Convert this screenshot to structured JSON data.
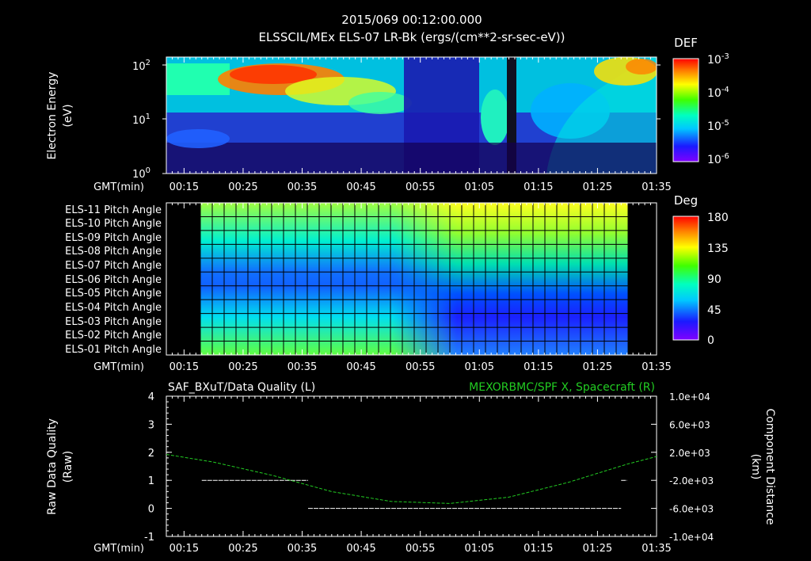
{
  "header": {
    "title_line1": "2015/069 00:12:00.000",
    "title_line2": "ELSSCIL/MEx ELS-07 LR-Bk  (ergs/(cm**2-sr-sec-eV))"
  },
  "time_axis": {
    "label": "GMT(min)",
    "ticks": [
      "00:15",
      "00:25",
      "00:35",
      "00:45",
      "00:55",
      "01:05",
      "01:15",
      "01:25",
      "01:35"
    ]
  },
  "panel1": {
    "ylabel_line1": "Electron Energy",
    "ylabel_line2": "(eV)",
    "yticks": [
      {
        "base": "10",
        "exp": "2"
      },
      {
        "base": "10",
        "exp": "1"
      },
      {
        "base": "10",
        "exp": "0"
      }
    ],
    "colorbar": {
      "title": "DEF",
      "ticks": [
        {
          "base": "10",
          "exp": "-3"
        },
        {
          "base": "10",
          "exp": "-4"
        },
        {
          "base": "10",
          "exp": "-5"
        },
        {
          "base": "10",
          "exp": "-6"
        }
      ]
    }
  },
  "panel2": {
    "row_labels": [
      "ELS-11 Pitch Angle",
      "ELS-10 Pitch Angle",
      "ELS-09 Pitch Angle",
      "ELS-08 Pitch Angle",
      "ELS-07 Pitch Angle",
      "ELS-06 Pitch Angle",
      "ELS-05 Pitch Angle",
      "ELS-04 Pitch Angle",
      "ELS-03 Pitch Angle",
      "ELS-02 Pitch Angle",
      "ELS-01 Pitch Angle"
    ],
    "colorbar": {
      "title": "Deg",
      "ticks": [
        "180",
        "135",
        "90",
        "45",
        "0"
      ]
    }
  },
  "panel3": {
    "title_left": "SAF_BXuT/Data Quality (L)",
    "title_right": "MEXORBMC/SPF X, Spacecraft (R)",
    "ylabel_left_line1": "Raw Data Quality",
    "ylabel_left_line2": "(Raw)",
    "ylabel_right_line1": "Component Distance",
    "ylabel_right_line2": "(km)",
    "yticks_left": [
      "4",
      "3",
      "2",
      "1",
      "0",
      "-1"
    ],
    "yticks_right": [
      "1.0e+04",
      "6.0e+03",
      "2.0e+03",
      "-2.0e+03",
      "-6.0e+03",
      "-1.0e+04"
    ]
  },
  "colors": {
    "background": "#000000",
    "foreground": "#ffffff",
    "spacecraft_x_line": "#22cc22"
  },
  "chart_data": [
    {
      "type": "heatmap",
      "title": "ELSSCIL/MEx ELS-07 LR-Bk  (ergs/(cm**2-sr-sec-eV))",
      "ylabel": "Electron Energy (eV)",
      "xlabel": "GMT(min)",
      "x_range": [
        "00:12",
        "01:35"
      ],
      "y_range": [
        1,
        150
      ],
      "y_scale": "log",
      "colorbar_label": "DEF",
      "color_range": [
        1e-06,
        0.001
      ],
      "color_scale": "log"
    },
    {
      "type": "heatmap",
      "ylabel": "Pitch Angle",
      "xlabel": "GMT(min)",
      "x_range": [
        "00:12",
        "01:35"
      ],
      "data_x_range": [
        "00:18",
        "01:30"
      ],
      "rows": [
        "ELS-01",
        "ELS-02",
        "ELS-03",
        "ELS-04",
        "ELS-05",
        "ELS-06",
        "ELS-07",
        "ELS-08",
        "ELS-09",
        "ELS-10",
        "ELS-11"
      ],
      "colorbar_label": "Deg",
      "color_range": [
        0,
        180
      ],
      "grid": true
    },
    {
      "type": "line",
      "xlabel": "GMT(min)",
      "x_range": [
        "00:12",
        "01:35"
      ],
      "series": [
        {
          "name": "SAF_BXuT/Data Quality (L)",
          "axis": "left",
          "segments": [
            {
              "x": [
                "00:18",
                "00:36"
              ],
              "y": 1
            },
            {
              "x": [
                "00:36",
                "01:29"
              ],
              "y": 0
            },
            {
              "x": [
                "01:29",
                "01:30"
              ],
              "y": 1
            }
          ]
        },
        {
          "name": "MEXORBMC/SPF X, Spacecraft (R)",
          "axis": "right",
          "x": [
            "00:12",
            "00:20",
            "00:30",
            "00:40",
            "00:50",
            "01:00",
            "01:10",
            "01:20",
            "01:30",
            "01:35"
          ],
          "y": [
            1700,
            600,
            -1300,
            -3600,
            -5000,
            -5300,
            -4400,
            -2300,
            300,
            1400
          ]
        }
      ],
      "ylim_left": [
        -1,
        4
      ],
      "ylim_right": [
        -10000,
        10000
      ]
    }
  ]
}
